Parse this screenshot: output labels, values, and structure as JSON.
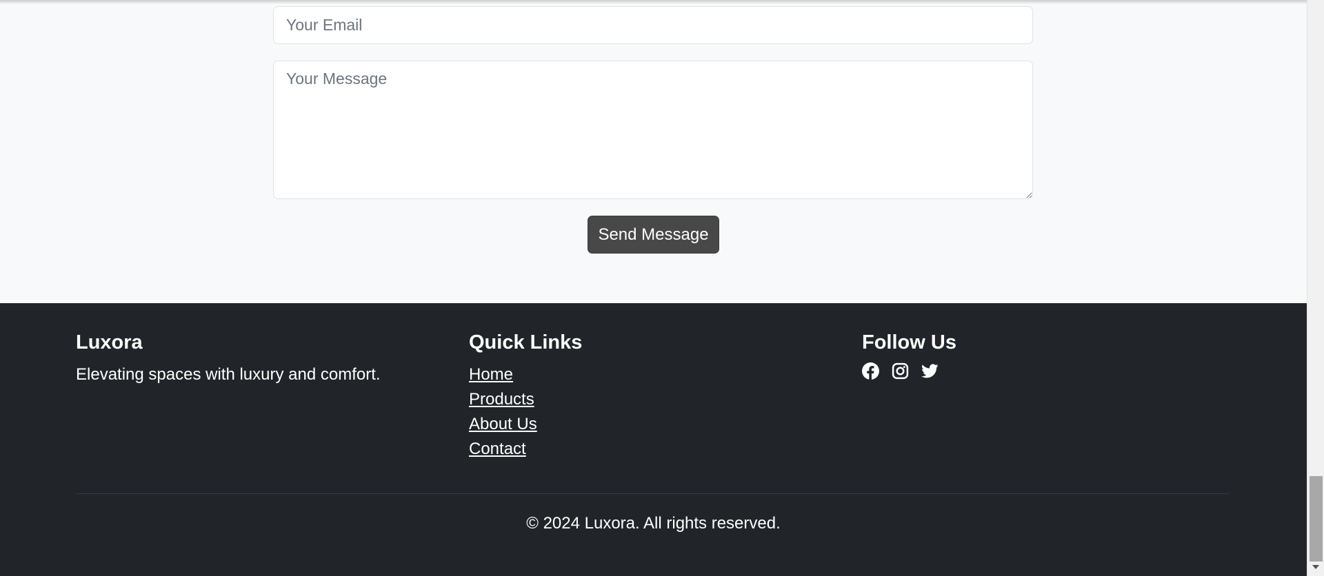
{
  "contact_form": {
    "email_placeholder": "Your Email",
    "message_placeholder": "Your Message",
    "submit_label": "Send Message"
  },
  "footer": {
    "brand": {
      "title": "Luxora",
      "tagline": "Elevating spaces with luxury and comfort."
    },
    "quick_links": {
      "title": "Quick Links",
      "items": [
        {
          "label": "Home"
        },
        {
          "label": "Products"
        },
        {
          "label": "About Us"
        },
        {
          "label": "Contact"
        }
      ]
    },
    "follow": {
      "title": "Follow Us",
      "icons": [
        "facebook-icon",
        "instagram-icon",
        "twitter-icon"
      ]
    },
    "copyright": "© 2024 Luxora. All rights reserved."
  },
  "colors": {
    "page_bg": "#f8f9fa",
    "footer_bg": "#212529",
    "button_bg": "#484848",
    "text_light": "#ffffff",
    "placeholder": "#6c757d"
  }
}
